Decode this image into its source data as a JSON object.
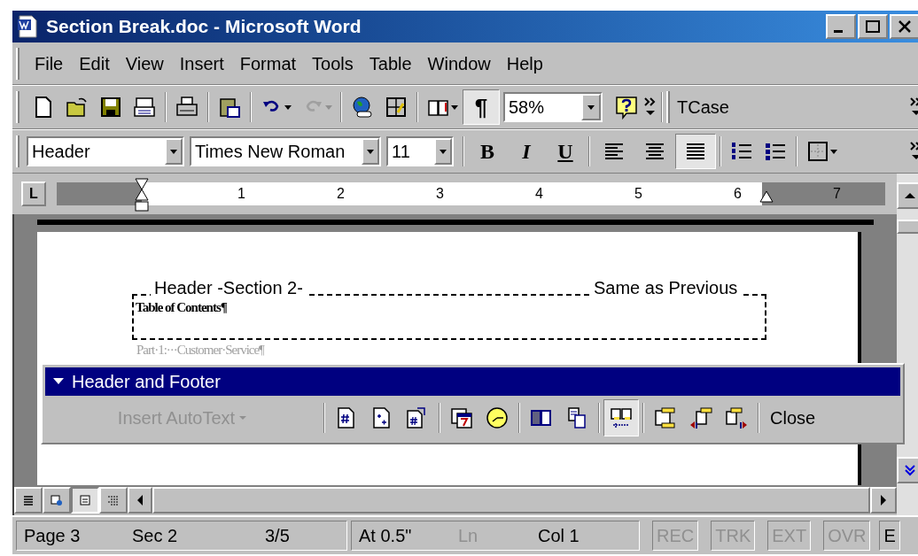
{
  "window": {
    "title": "Section Break.doc - Microsoft Word"
  },
  "menu": [
    "File",
    "Edit",
    "View",
    "Insert",
    "Format",
    "Tools",
    "Table",
    "Window",
    "Help"
  ],
  "standard_toolbar": {
    "show_hide_selected": true,
    "pilcrow": "¶",
    "zoom": "58%",
    "extra_toolbar": "TCase"
  },
  "formatting_toolbar": {
    "style": "Header",
    "font": "Times New Roman",
    "size": "11",
    "bold": "B",
    "italic": "I",
    "underline": "U",
    "alignment": [
      {
        "selected": false
      },
      {
        "selected": false
      },
      {
        "selected": true
      }
    ]
  },
  "ruler": {
    "tab_selector": "L",
    "numbers": [
      "1",
      "2",
      "3",
      "4",
      "5",
      "6",
      "7"
    ]
  },
  "document": {
    "header_label": "Header -Section 2-",
    "link_label": "Same as Previous",
    "header_text": "Table of Contents¶",
    "body_text": "Part·1:···Customer·Service¶"
  },
  "header_footer_toolbar": {
    "title": "Header and Footer",
    "autotext": {
      "label": "Insert AutoText",
      "disabled": true
    },
    "buttons": [
      {
        "selected": false
      },
      {
        "selected": false
      },
      {
        "selected": false
      },
      {
        "selected": false
      },
      {
        "selected": false
      },
      {
        "selected": false
      },
      {
        "selected": false
      },
      {
        "selected": true
      },
      {
        "selected": false
      },
      {
        "selected": false
      },
      {
        "selected": false
      }
    ],
    "close": "Close"
  },
  "view_buttons": [
    {
      "selected": false
    },
    {
      "selected": false
    },
    {
      "selected": true
    },
    {
      "selected": false
    }
  ],
  "status_bar": {
    "page": "Page 3",
    "section": "Sec 2",
    "pages": "3/5",
    "at": "At 0.5\"",
    "line": {
      "label": "Ln",
      "disabled": true
    },
    "column": "Col 1",
    "modes": [
      {
        "label": "REC",
        "disabled": true
      },
      {
        "label": "TRK",
        "disabled": true
      },
      {
        "label": "EXT",
        "disabled": true
      },
      {
        "label": "OVR",
        "disabled": true
      }
    ],
    "language": "E"
  }
}
